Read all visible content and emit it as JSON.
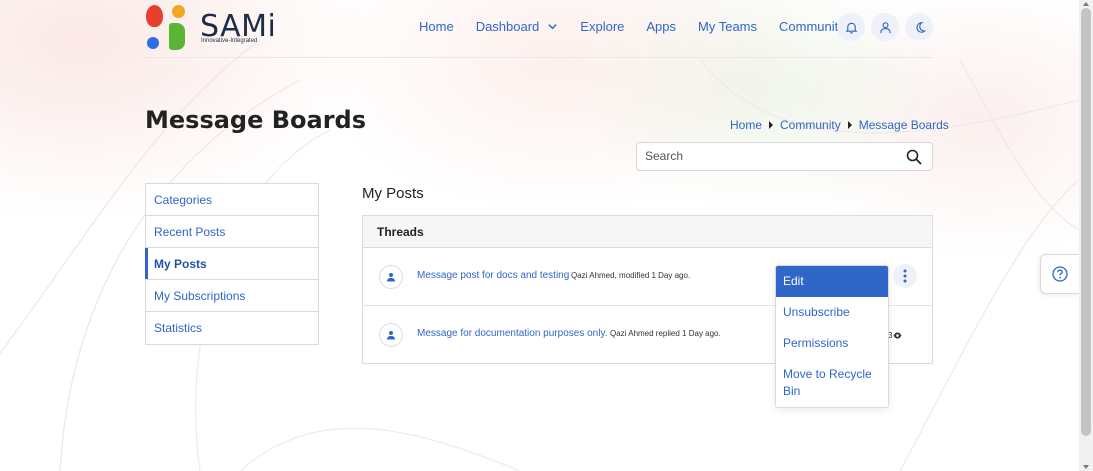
{
  "logo": {
    "name": "SAMi",
    "tagline": "Innovative-Integrated"
  },
  "nav": {
    "items": [
      {
        "label": "Home"
      },
      {
        "label": "Dashboard"
      },
      {
        "label": "Explore"
      },
      {
        "label": "Apps"
      },
      {
        "label": "My Teams"
      },
      {
        "label": "Community"
      }
    ],
    "icons": [
      "bell-icon",
      "user-icon",
      "moon-icon"
    ]
  },
  "page": {
    "title": "Message Boards"
  },
  "breadcrumb": [
    "Home",
    "Community",
    "Message Boards"
  ],
  "search": {
    "placeholder": "Search"
  },
  "sidebar": {
    "items": [
      {
        "label": "Categories"
      },
      {
        "label": "Recent Posts"
      },
      {
        "label": "My Posts",
        "active": true
      },
      {
        "label": "My Subscriptions"
      },
      {
        "label": "Statistics"
      }
    ]
  },
  "main": {
    "section_title": "My Posts",
    "threads_header": "Threads",
    "threads": [
      {
        "title": "Message post for docs and testing",
        "meta": "Qazi Ahmed, modified 1 Day ago."
      },
      {
        "title": "Message for documentation purposes only.",
        "meta": "Qazi Ahmed replied 1 Day ago.",
        "views": "3"
      }
    ]
  },
  "dropdown": {
    "items": [
      "Edit",
      "Unsubscribe",
      "Permissions",
      "Move to Recycle Bin"
    ]
  },
  "colors": {
    "accent": "#2f66c8",
    "text": "#222222"
  }
}
